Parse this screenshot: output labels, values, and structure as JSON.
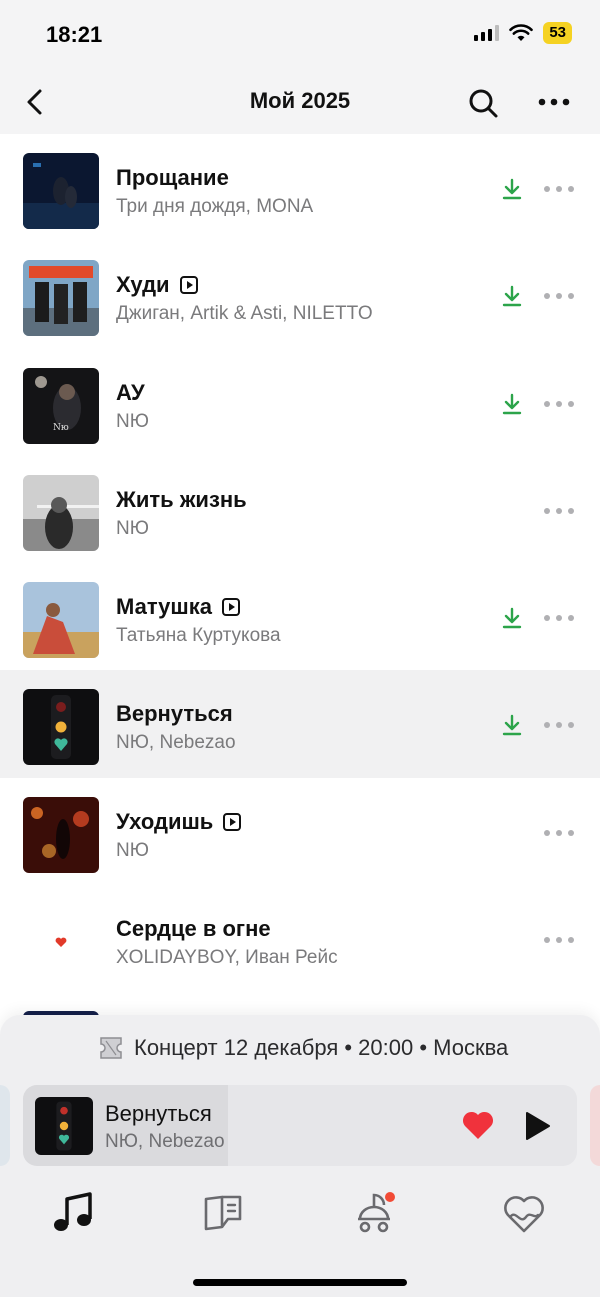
{
  "status": {
    "time": "18:21",
    "battery": "53"
  },
  "header": {
    "title": "Мой 2025"
  },
  "tracks": [
    {
      "title": "Прощание",
      "artist": "Три дня дождя, MONA",
      "video": false,
      "downloaded": true,
      "active": false
    },
    {
      "title": "Худи",
      "artist": "Джиган, Artik & Asti, NILETTO",
      "video": true,
      "downloaded": true,
      "active": false
    },
    {
      "title": "АУ",
      "artist": "NЮ",
      "video": false,
      "downloaded": true,
      "active": false
    },
    {
      "title": "Жить жизнь",
      "artist": "NЮ",
      "video": false,
      "downloaded": false,
      "active": false
    },
    {
      "title": "Матушка",
      "artist": "Татьяна Куртукова",
      "video": true,
      "downloaded": true,
      "active": false
    },
    {
      "title": "Вернуться",
      "artist": "NЮ, Nebezao",
      "video": false,
      "downloaded": true,
      "active": true
    },
    {
      "title": "Уходишь",
      "artist": "NЮ",
      "video": true,
      "downloaded": false,
      "active": false
    },
    {
      "title": "Сердце в огне",
      "artist": "XOLIDAYBOY, Иван Рейс",
      "video": false,
      "downloaded": false,
      "active": false
    }
  ],
  "concert": {
    "text": "Концерт 12 декабря • 20:00 • Москва"
  },
  "player": {
    "title": "Вернуться",
    "artist": "NЮ, Nebezao",
    "liked": true,
    "progress": 0.37
  },
  "colors": {
    "accent_green": "#2ca44a",
    "heart_red": "#f0323c",
    "notification_dot": "#f24b36"
  },
  "tabs": [
    {
      "icon": "music-note-icon",
      "active": true
    },
    {
      "icon": "book-icon",
      "active": false
    },
    {
      "icon": "kids-icon",
      "active": false,
      "badge": true
    },
    {
      "icon": "heart-wave-icon",
      "active": false
    }
  ]
}
